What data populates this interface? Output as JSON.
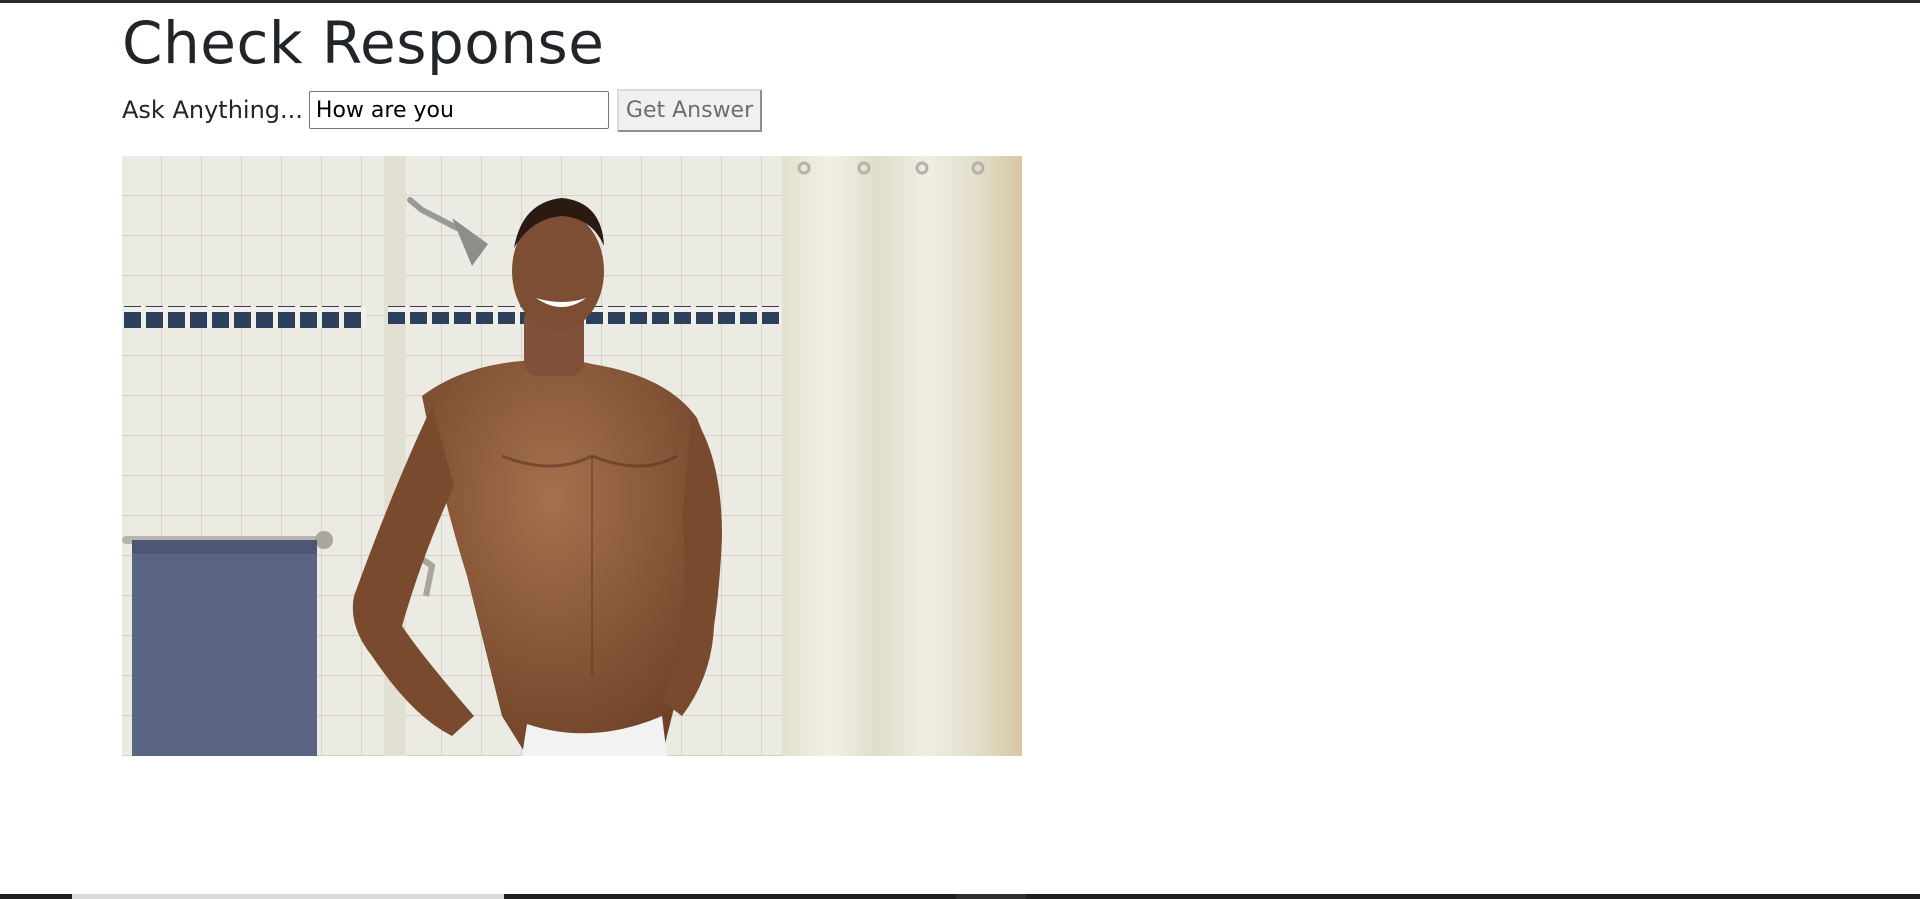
{
  "page": {
    "title": "Check Response"
  },
  "form": {
    "label": "Ask Anything...",
    "input_value": "How are you",
    "button_label": "Get Answer"
  },
  "image": {
    "alt": "",
    "colors": {
      "tile": "#ecebe3",
      "tile_accent": "#2c3f5c",
      "curtain": "#ebe8da",
      "towel": "#5a6584",
      "skin": "#8a5a3c"
    }
  }
}
